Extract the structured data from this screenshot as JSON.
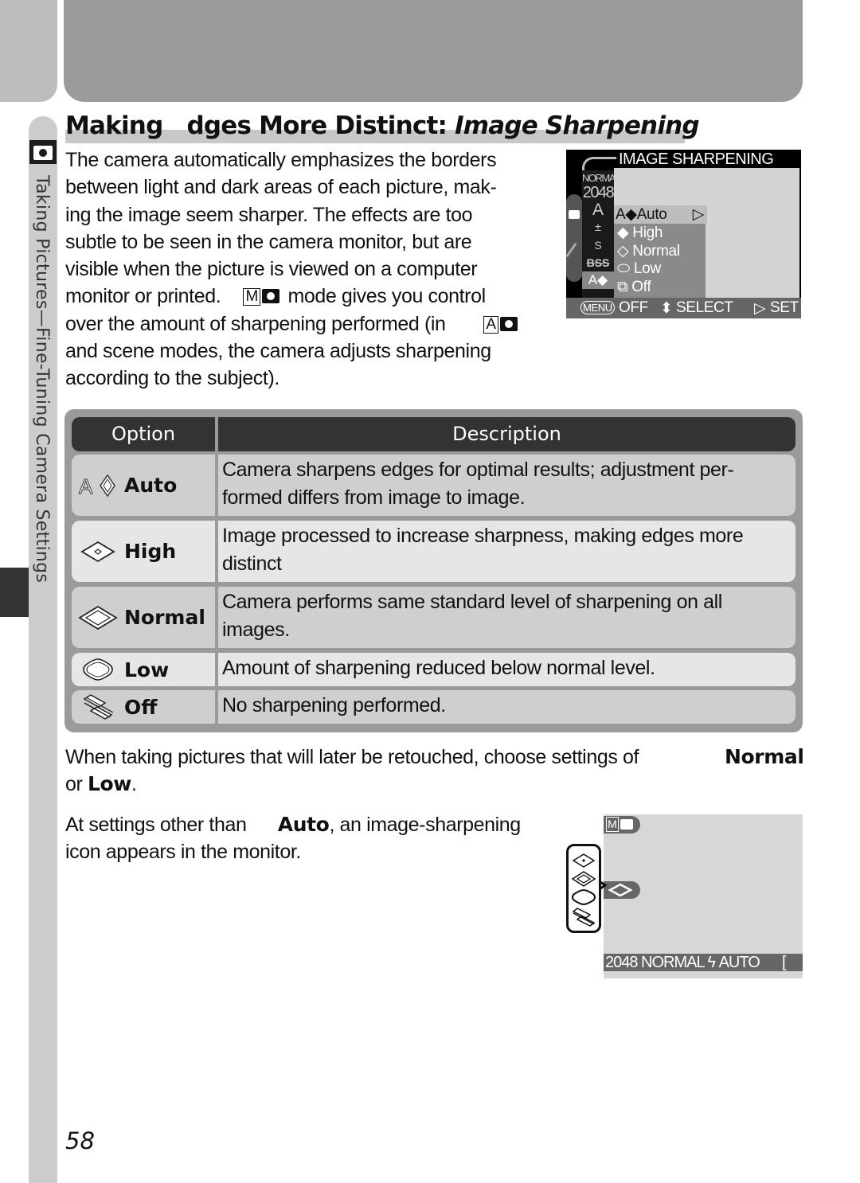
{
  "page": {
    "number": "58",
    "section_tab": "Taking Pictures—Fine-Tuning Camera Settings",
    "section_icon": "camera-icon"
  },
  "title": {
    "plain": "Making   dges More Distinct: ",
    "italic": "Image Sharpening"
  },
  "intro": {
    "line1": "The camera automatically emphasizes the borders",
    "line2": "between light and dark areas of each picture, mak-",
    "line3": "ing the image seem sharper.  The effects are too",
    "line4": "subtle to be seen in the camera monitor, but are",
    "line5": "visible when the picture is viewed on a computer",
    "line6a": "monitor or printed.",
    "mode_manual": "M",
    "line6b": "mode gives you control",
    "line7a": "over the amount of sharpening performed (in",
    "mode_auto": "A",
    "line8": "and scene modes, the camera adjusts sharpening",
    "line9": "according to the subject)."
  },
  "monitor_menu": {
    "title": "IMAGE SHARPENING",
    "strip": [
      "NORMAL",
      "2048",
      "A",
      "±",
      "S",
      "BSS",
      "A◆"
    ],
    "items": [
      {
        "label": "Auto",
        "prefix": "A◆",
        "selected": true
      },
      {
        "label": "High",
        "selected": false
      },
      {
        "label": "Normal",
        "selected": false
      },
      {
        "label": "Low",
        "selected": false
      },
      {
        "label": "Off",
        "selected": false
      }
    ],
    "bar": {
      "menu": "MENU",
      "off": "OFF",
      "select": "SELECT",
      "set": "SET"
    }
  },
  "table": {
    "headers": {
      "option": "Option",
      "description": "Description"
    },
    "rows": [
      {
        "option": "Auto",
        "icon": "auto-sharpening-icon",
        "line1": "Camera sharpens edges for optimal results; adjustment per-",
        "line2": "formed differs from image to image."
      },
      {
        "option": "High",
        "icon": "high-sharpening-icon",
        "line1": "Image processed to increase sharpness, making edges more",
        "line2": "distinct"
      },
      {
        "option": "Normal",
        "icon": "normal-sharpening-icon",
        "line1": "Camera performs same standard level of sharpening on all",
        "line2": "images."
      },
      {
        "option": "Low",
        "icon": "low-sharpening-icon",
        "line1": "Amount of sharpening reduced below normal level.",
        "line2": ""
      },
      {
        "option": "Off",
        "icon": "off-sharpening-icon",
        "line1": "No sharpening performed.",
        "line2": ""
      }
    ]
  },
  "para2": {
    "text": "When taking pictures that will later be retouched, choose settings of",
    "normal": "Normal",
    "line2_pre": "or ",
    "low": "Low",
    "line2_post": "."
  },
  "para3": {
    "pre": "At settings other than ",
    "auto": "Auto",
    "post": ", an image-sharpening",
    "line2": "icon appears in the monitor."
  },
  "monitor_display": {
    "mode": "M",
    "status_bar": "2048 NORMAL ϟ AUTO",
    "bracket": "["
  }
}
